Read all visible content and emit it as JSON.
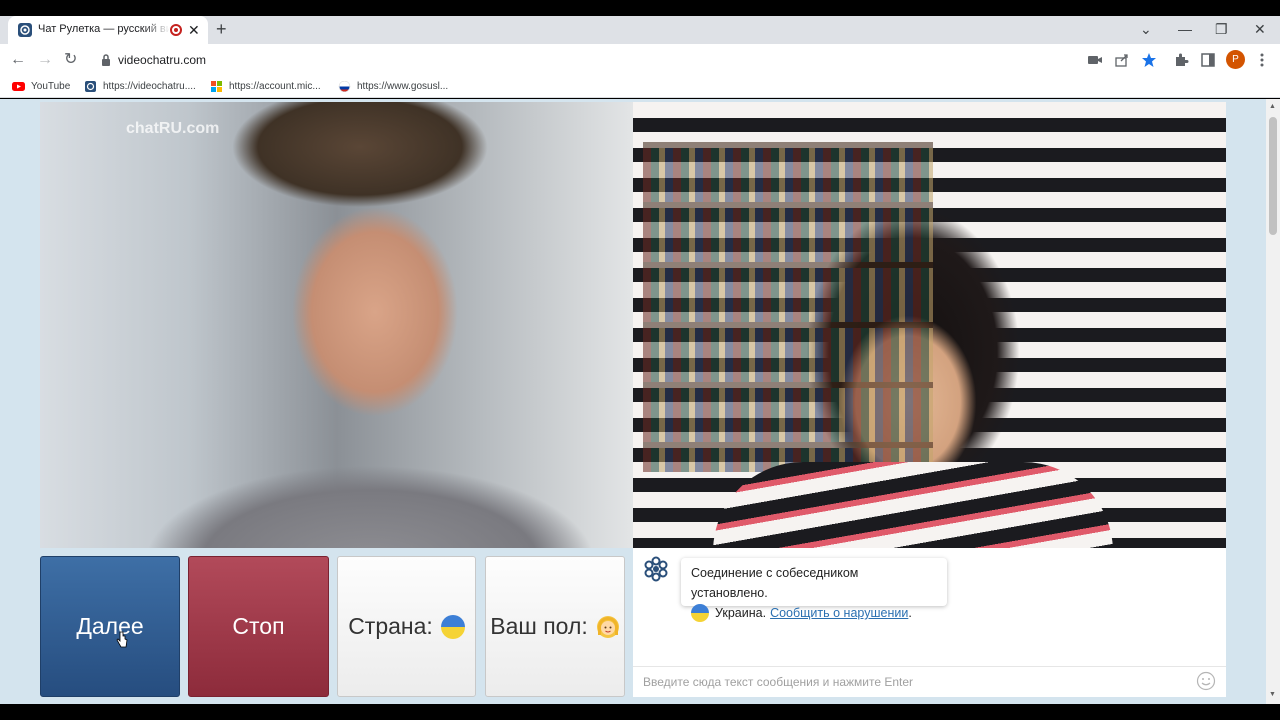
{
  "browser": {
    "tab_title": "Чат Рулетка — русский видеочат",
    "tab_close": "✕",
    "new_tab": "+",
    "url": "videochatru.com",
    "avatar_letter": "P",
    "controls": {
      "list": "⌄",
      "minimize": "—",
      "restore": "❐",
      "close": "✕"
    }
  },
  "bookmarks": [
    {
      "label": "YouTube"
    },
    {
      "label": "https://videochatru...."
    },
    {
      "label": "https://account.mic..."
    },
    {
      "label": "https://www.gosusl..."
    }
  ],
  "video": {
    "watermark": "chatRU.com"
  },
  "buttons": {
    "next": "Далее",
    "stop": "Стоп",
    "country": "Страна:",
    "gender": "Ваш пол:"
  },
  "chat": {
    "message_line1": "Соединение с собеседником установлено.",
    "country_text": "Украина.",
    "report_link": "Сообщить о нарушении",
    "period": ".",
    "input_placeholder": "Введите сюда текст сообщения и нажмите Enter"
  },
  "colors": {
    "next_button": "#2f5d92",
    "stop_button": "#9e3848",
    "page_background": "#d4e4ee",
    "link": "#2a6fb0"
  }
}
